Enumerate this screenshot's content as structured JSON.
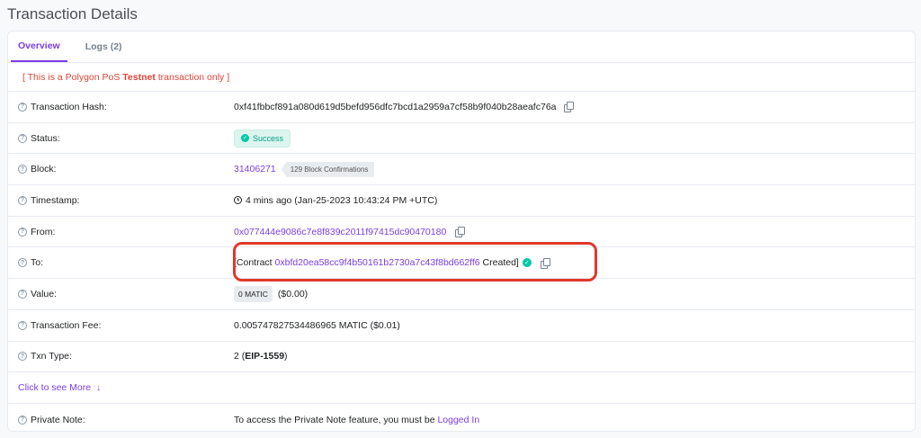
{
  "page": {
    "title": "Transaction Details"
  },
  "tabs": [
    {
      "label": "Overview",
      "active": true
    },
    {
      "label": "Logs (2)",
      "active": false
    }
  ],
  "notice": {
    "prefix": "[ This is a Polygon PoS ",
    "bold": "Testnet",
    "suffix": " transaction only ]"
  },
  "rows": {
    "hash": {
      "label": "Transaction Hash:",
      "value": "0xf41fbbcf891a080d619d5befd956dfc7bcd1a2959a7cf58b9f040b28aeafc76a"
    },
    "status": {
      "label": "Status:",
      "value": "Success"
    },
    "block": {
      "label": "Block:",
      "value": "31406271",
      "confirmations": "129 Block Confirmations"
    },
    "timestamp": {
      "label": "Timestamp:",
      "value": "4 mins ago (Jan-25-2023 10:43:24 PM +UTC)"
    },
    "from": {
      "label": "From:",
      "value": "0x077444e9086c7e8f839c2011f97415dc90470180"
    },
    "to": {
      "label": "To:",
      "prefix": "[Contract ",
      "address": "0xbfd20ea58cc9f4b50161b2730a7c43f8bd662ff6",
      "suffix": " Created]"
    },
    "value": {
      "label": "Value:",
      "amount": "0 MATIC",
      "usd": "($0.00)"
    },
    "fee": {
      "label": "Transaction Fee:",
      "value": "0.005747827534486965 MATIC ($0.01)"
    },
    "txn_type": {
      "label": "Txn Type:",
      "prefix": "2 (",
      "bold": "EIP-1559",
      "suffix": ")"
    },
    "private_note": {
      "label": "Private Note:",
      "text": "To access the Private Note feature, you must be ",
      "link": "Logged In"
    }
  },
  "more": {
    "label": "Click to see More"
  },
  "colors": {
    "accent": "#7b3fe4",
    "success": "#00c9a7",
    "danger": "#de4437",
    "highlight": "#e0382b"
  }
}
